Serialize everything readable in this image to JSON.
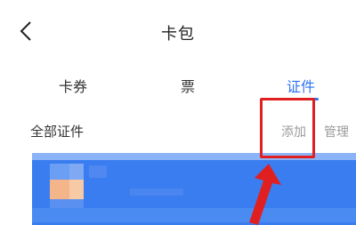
{
  "header": {
    "title": "卡包",
    "back_icon": "chevron-left-icon"
  },
  "tabs": [
    {
      "label": "卡券"
    },
    {
      "label": "票"
    },
    {
      "label": "证件",
      "active": true
    }
  ],
  "section": {
    "title": "全部证件",
    "add_label": "添加",
    "manage_label": "管理"
  },
  "colors": {
    "accent": "#2f74f2",
    "highlight": "#e02020",
    "card": "#3a7df0"
  }
}
